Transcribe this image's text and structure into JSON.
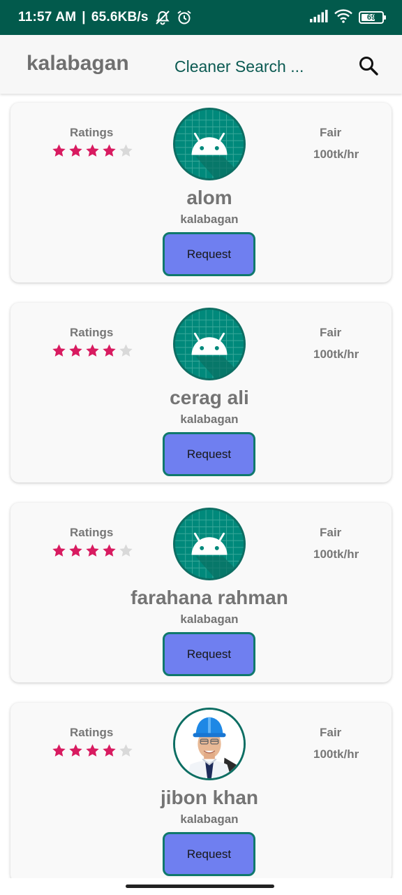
{
  "status_bar": {
    "time": "11:57 AM",
    "separator": "|",
    "speed": "65.6KB/s",
    "battery": "69",
    "battery_level": 0.69,
    "background": "#025a4c"
  },
  "app_bar": {
    "title": "kalabagan",
    "subtitle": "Cleaner Search ...",
    "search_icon": "search-icon"
  },
  "cards": [
    {
      "ratings_label": "Ratings",
      "stars": 4,
      "max_stars": 5,
      "fair_label": "Fair",
      "rate": "100tk/hr",
      "name": "alom",
      "location": "kalabagan",
      "avatar": "android-icon",
      "button": "Request"
    },
    {
      "ratings_label": "Ratings",
      "stars": 4,
      "max_stars": 5,
      "fair_label": "Fair",
      "rate": "100tk/hr",
      "name": "cerag ali",
      "location": "kalabagan",
      "avatar": "android-icon",
      "button": "Request"
    },
    {
      "ratings_label": "Ratings",
      "stars": 4,
      "max_stars": 5,
      "fair_label": "Fair",
      "rate": "100tk/hr",
      "name": "farahana rahman",
      "location": "kalabagan",
      "avatar": "android-icon",
      "button": "Request"
    },
    {
      "ratings_label": "Ratings",
      "stars": 4,
      "max_stars": 5,
      "fair_label": "Fair",
      "rate": "100tk/hr",
      "name": "jibon khan",
      "location": "kalabagan",
      "avatar": "worker-photo",
      "button": "Request"
    }
  ],
  "colors": {
    "accent": "#025a4c",
    "star_filled": "#d81b60",
    "star_empty": "#d9d9d9",
    "button_fill": "#6f7ff0",
    "button_border": "#10796c"
  }
}
